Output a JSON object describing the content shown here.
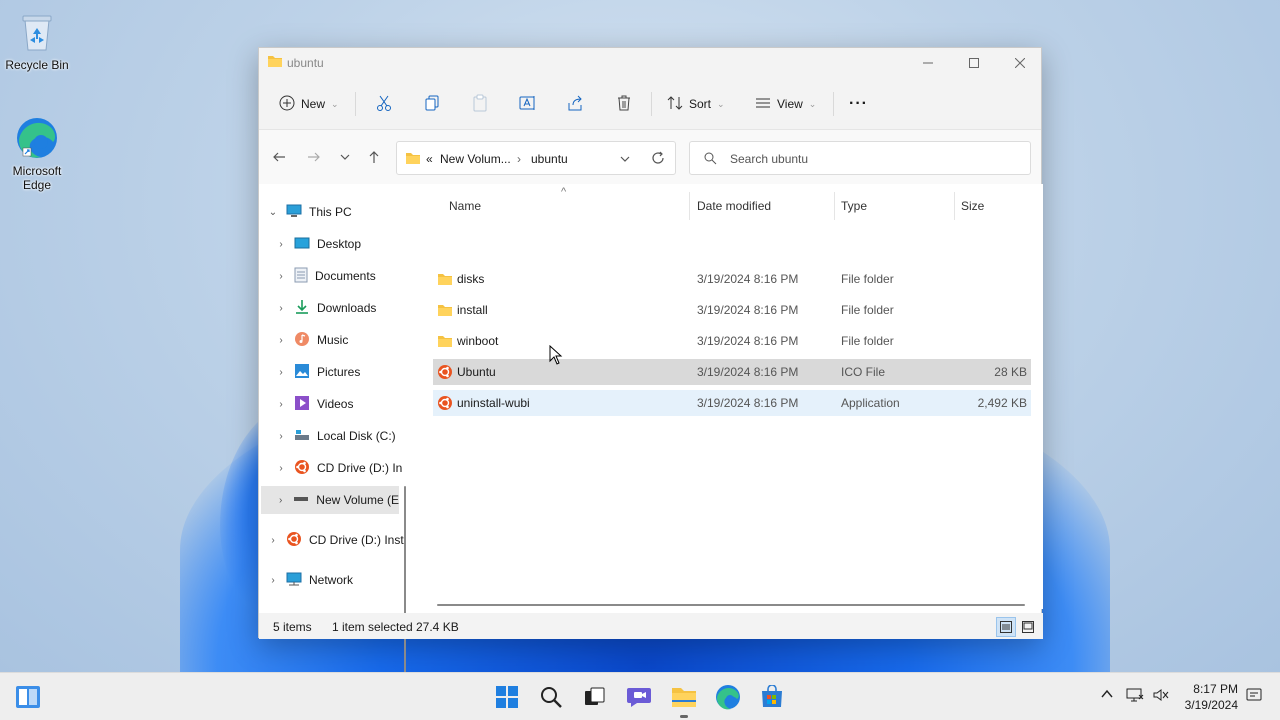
{
  "desktop": {
    "icons": [
      {
        "label": "Recycle Bin"
      },
      {
        "label": "Microsoft Edge"
      }
    ]
  },
  "window": {
    "title": "ubuntu",
    "commands": {
      "new": "New",
      "sort": "Sort",
      "view": "View",
      "more": "···"
    },
    "address": {
      "overflow": "«",
      "crumbs": [
        "New Volum...",
        "ubuntu"
      ],
      "separator": "›"
    },
    "search": {
      "placeholder": "Search ubuntu"
    },
    "nav_tree": [
      {
        "label": "This PC",
        "icon": "this-pc-icon"
      },
      {
        "label": "Desktop",
        "icon": "desktop-icon"
      },
      {
        "label": "Documents",
        "icon": "documents-icon"
      },
      {
        "label": "Downloads",
        "icon": "downloads-icon"
      },
      {
        "label": "Music",
        "icon": "music-icon"
      },
      {
        "label": "Pictures",
        "icon": "pictures-icon"
      },
      {
        "label": "Videos",
        "icon": "videos-icon"
      },
      {
        "label": "Local Disk (C:)",
        "icon": "local-disk-icon"
      },
      {
        "label": "CD Drive (D:) In",
        "icon": "cd-drive-icon"
      },
      {
        "label": "New Volume (E",
        "icon": "drive-icon"
      },
      {
        "label": "CD Drive (D:) Inst",
        "icon": "cd-drive-icon"
      },
      {
        "label": "Network",
        "icon": "network-icon"
      }
    ],
    "columns": {
      "name": "Name",
      "date": "Date modified",
      "type": "Type",
      "size": "Size",
      "sort_glyph": "^"
    },
    "files": [
      {
        "name": "disks",
        "date": "3/19/2024 8:16 PM",
        "type": "File folder",
        "size": "",
        "icon": "folder-icon"
      },
      {
        "name": "install",
        "date": "3/19/2024 8:16 PM",
        "type": "File folder",
        "size": "",
        "icon": "folder-icon"
      },
      {
        "name": "winboot",
        "date": "3/19/2024 8:16 PM",
        "type": "File folder",
        "size": "",
        "icon": "folder-icon"
      },
      {
        "name": "Ubuntu",
        "date": "3/19/2024 8:16 PM",
        "type": "ICO File",
        "size": "28 KB",
        "icon": "ubuntu-icon"
      },
      {
        "name": "uninstall-wubi",
        "date": "3/19/2024 8:16 PM",
        "type": "Application",
        "size": "2,492 KB",
        "icon": "ubuntu-icon"
      }
    ],
    "status": {
      "count": "5 items",
      "selected": "1 item selected",
      "size": "27.4 KB"
    }
  },
  "taskbar": {
    "clock": {
      "time": "8:17 PM",
      "date": "3/19/2024"
    }
  },
  "colors": {
    "accent": "#0067c0",
    "folder": "#f5c242",
    "ubuntu": "#e95420",
    "selection": "#d9d9d9",
    "hover": "#e5f1fb"
  }
}
